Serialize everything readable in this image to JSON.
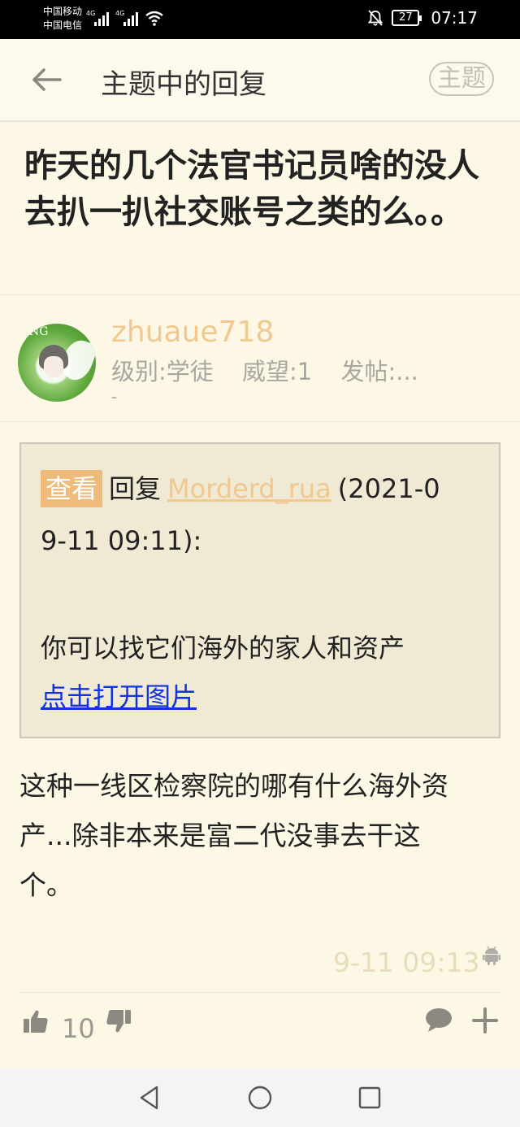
{
  "status_bar": {
    "carrier1": "中国移动",
    "carrier2": "中国电信",
    "network1": "4G",
    "network2": "4G",
    "battery": "27",
    "time": "07:17"
  },
  "header": {
    "title": "主题中的回复",
    "topic_button": "主题"
  },
  "post": {
    "title": "昨天的几个法官书记员啥的没人去扒一扒社交账号之类的么。。"
  },
  "author": {
    "username": "zhuaue718",
    "level": "级别:学徒",
    "prestige": "威望:1",
    "posts": "发帖:...",
    "posts_overflow": "-",
    "avatar_text": "NG"
  },
  "quote": {
    "view_label": "查看",
    "reply_label": "回复",
    "quoted_user": "Morderd_rua",
    "date_part1": "(2021-0",
    "date_part2": "9-11 09:11):",
    "content": "你可以找它们海外的家人和资产",
    "open_image_link": "点击打开图片"
  },
  "reply": {
    "line1": "这种一线区检察院的哪有什么海外资",
    "line2": "产...除非本来是富二代没事去干这",
    "line3": "个。",
    "timestamp": "9-11 09:13"
  },
  "actions": {
    "like_count": "10"
  },
  "colors": {
    "background": "#fdf8e6",
    "accent": "#efbb7a",
    "username": "#f0c890",
    "link": "#1133dd",
    "quote_bg": "#f0e9d3"
  },
  "icons": [
    "back-arrow-icon",
    "thumbs-up-icon",
    "thumbs-down-icon",
    "comment-icon",
    "plus-icon",
    "android-icon",
    "nav-back-icon",
    "nav-home-icon",
    "nav-recent-icon"
  ]
}
